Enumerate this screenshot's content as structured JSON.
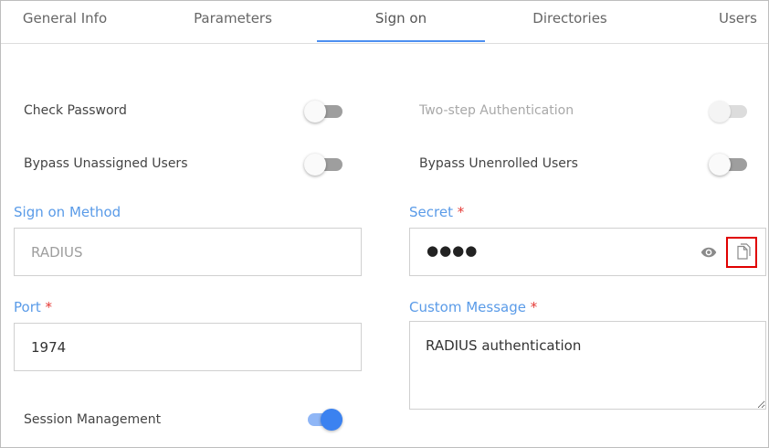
{
  "tabs": [
    {
      "label": "General Info"
    },
    {
      "label": "Parameters"
    },
    {
      "label": "Sign on",
      "active": true
    },
    {
      "label": "Directories"
    },
    {
      "label": "Users"
    }
  ],
  "toggles": {
    "check_password": {
      "label": "Check Password",
      "on": false
    },
    "two_step": {
      "label": "Two-step Authentication",
      "on": false,
      "disabled": true
    },
    "bypass_unassigned": {
      "label": "Bypass Unassigned Users",
      "on": false
    },
    "bypass_unenrolled": {
      "label": "Bypass Unenrolled Users",
      "on": false
    },
    "session_management": {
      "label": "Session Management",
      "on": true
    }
  },
  "fields": {
    "sign_on_method": {
      "label": "Sign on Method",
      "value": "RADIUS"
    },
    "secret": {
      "label": "Secret",
      "required_mark": "*",
      "masked_value": "●●●●"
    },
    "port": {
      "label": "Port",
      "required_mark": "*",
      "value": "1974"
    },
    "custom_message": {
      "label": "Custom Message",
      "required_mark": "*",
      "value": "RADIUS authentication"
    }
  },
  "icons": {
    "show_secret": "eye-icon",
    "copy_secret": "copy-icon"
  },
  "colors": {
    "accent": "#4d8ff0",
    "label_blue": "#5a9be8",
    "required_red": "#e53935",
    "highlight_red": "#e00000",
    "toggle_on": "#3b82f0"
  }
}
